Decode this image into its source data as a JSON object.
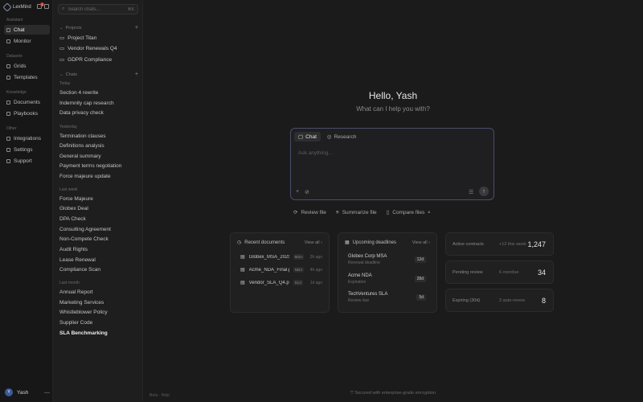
{
  "app": {
    "brand": "LexMind",
    "notif_count": "1"
  },
  "nav": {
    "sections": [
      {
        "label": "Assistant"
      },
      {
        "label": "Datasets"
      },
      {
        "label": "Knowledge"
      },
      {
        "label": "Other"
      }
    ],
    "items": [
      {
        "label": "Chat",
        "icon": "chat-icon"
      },
      {
        "label": "Monitor",
        "icon": "monitor-icon"
      },
      {
        "label": "Grids",
        "icon": "grid-icon"
      },
      {
        "label": "Templates",
        "icon": "template-icon"
      },
      {
        "label": "Documents",
        "icon": "document-icon"
      },
      {
        "label": "Playbooks",
        "icon": "book-icon"
      },
      {
        "label": "Integrations",
        "icon": "plug-icon"
      },
      {
        "label": "Settings",
        "icon": "gear-icon"
      },
      {
        "label": "Support",
        "icon": "help-icon"
      }
    ],
    "user": {
      "initial": "Y",
      "name": "Yash"
    }
  },
  "panel": {
    "search_placeholder": "Search chats...",
    "search_shortcut": "⌘K",
    "projects_label": "Projects",
    "projects": [
      "Project Titan",
      "Vendor Renewals Q4",
      "GDPR Compliance"
    ],
    "chats_label": "Chats",
    "groups": [
      {
        "label": "Today",
        "items": [
          "Section 4 rewrite",
          "Indemnity cap research",
          "Data privacy check"
        ]
      },
      {
        "label": "Yesterday",
        "items": [
          "Termination clauses",
          "Definitions analysis",
          "General summary",
          "Payment terms negotiation",
          "Force majeure update"
        ]
      },
      {
        "label": "Last week",
        "items": [
          "Force Majeure",
          "Globex Deal",
          "DPA Check",
          "Consulting Agreement",
          "Non-Compete Check",
          "Audit Rights",
          "Lease Renewal",
          "Compliance Scan"
        ]
      },
      {
        "label": "Last month",
        "items": [
          "Annual Report",
          "Marketing Services",
          "Whistleblower Policy",
          "Supplier Code",
          "SLA Benchmarking"
        ]
      }
    ]
  },
  "main": {
    "greeting": "Hello, Yash",
    "subgreeting": "What can I help you with?",
    "composer": {
      "tabs": [
        "Chat",
        "Research"
      ],
      "placeholder": "Ask anything..."
    },
    "actions": [
      "Review file",
      "Summarize file",
      "Compare files"
    ],
    "recent_docs": {
      "title": "Recent documents",
      "view_all": "View all",
      "rows": [
        {
          "name": "Globex_MSA_2025",
          "tag": "MSA",
          "time": "2h ago"
        },
        {
          "name": "Acme_NDA_Final.p",
          "tag": "NDA",
          "time": "4h ago"
        },
        {
          "name": "Vendor_SLA_Q4.p",
          "tag": "SLA",
          "time": "1d ago"
        }
      ]
    },
    "deadlines": {
      "title": "Upcoming deadlines",
      "view_all": "View all",
      "rows": [
        {
          "name": "Globex Corp MSA",
          "sub": "Renewal deadline",
          "days": "12d"
        },
        {
          "name": "Acme NDA",
          "sub": "Expiration",
          "days": "28d"
        },
        {
          "name": "TechVentures SLA",
          "sub": "Review due",
          "days": "5d"
        }
      ]
    },
    "stats": [
      {
        "label": "Active contracts",
        "sub": "+12 this week",
        "value": "1,247"
      },
      {
        "label": "Pending review",
        "sub": "6 overdue",
        "value": "34"
      },
      {
        "label": "Expiring (30d)",
        "sub": "3 auto-renew",
        "value": "8"
      }
    ],
    "footer_left": "Beta · Help",
    "footer_center": "Secured with enterprise-grade encryption"
  },
  "colors": {
    "accent": "#4a4d6a",
    "badge": "#c0392b"
  }
}
